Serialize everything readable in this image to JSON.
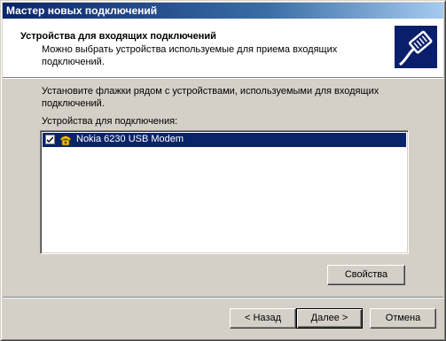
{
  "window": {
    "title": "Мастер новых подключений"
  },
  "header": {
    "title": "Устройства для входящих подключений",
    "subtitle": "Можно выбрать устройства используемые для приема входящих подключений.",
    "icon": "network-cable-icon"
  },
  "body": {
    "intro": "Установите флажки рядом с устройствами, используемыми для входящих подключений.",
    "list_label": "Устройства для подключения:",
    "devices": [
      {
        "label": "Nokia 6230 USB Modem",
        "checked": true,
        "selected": true,
        "icon": "modem-phone-icon"
      }
    ]
  },
  "buttons": {
    "properties": "Свойства",
    "back": "< Назад",
    "next": "Далее >",
    "cancel": "Отмена"
  },
  "colors": {
    "title_bar": "#0a246a",
    "selection": "#0a246a",
    "face": "#d4d0c8",
    "header_icon_bg": "#0a1f6b"
  }
}
